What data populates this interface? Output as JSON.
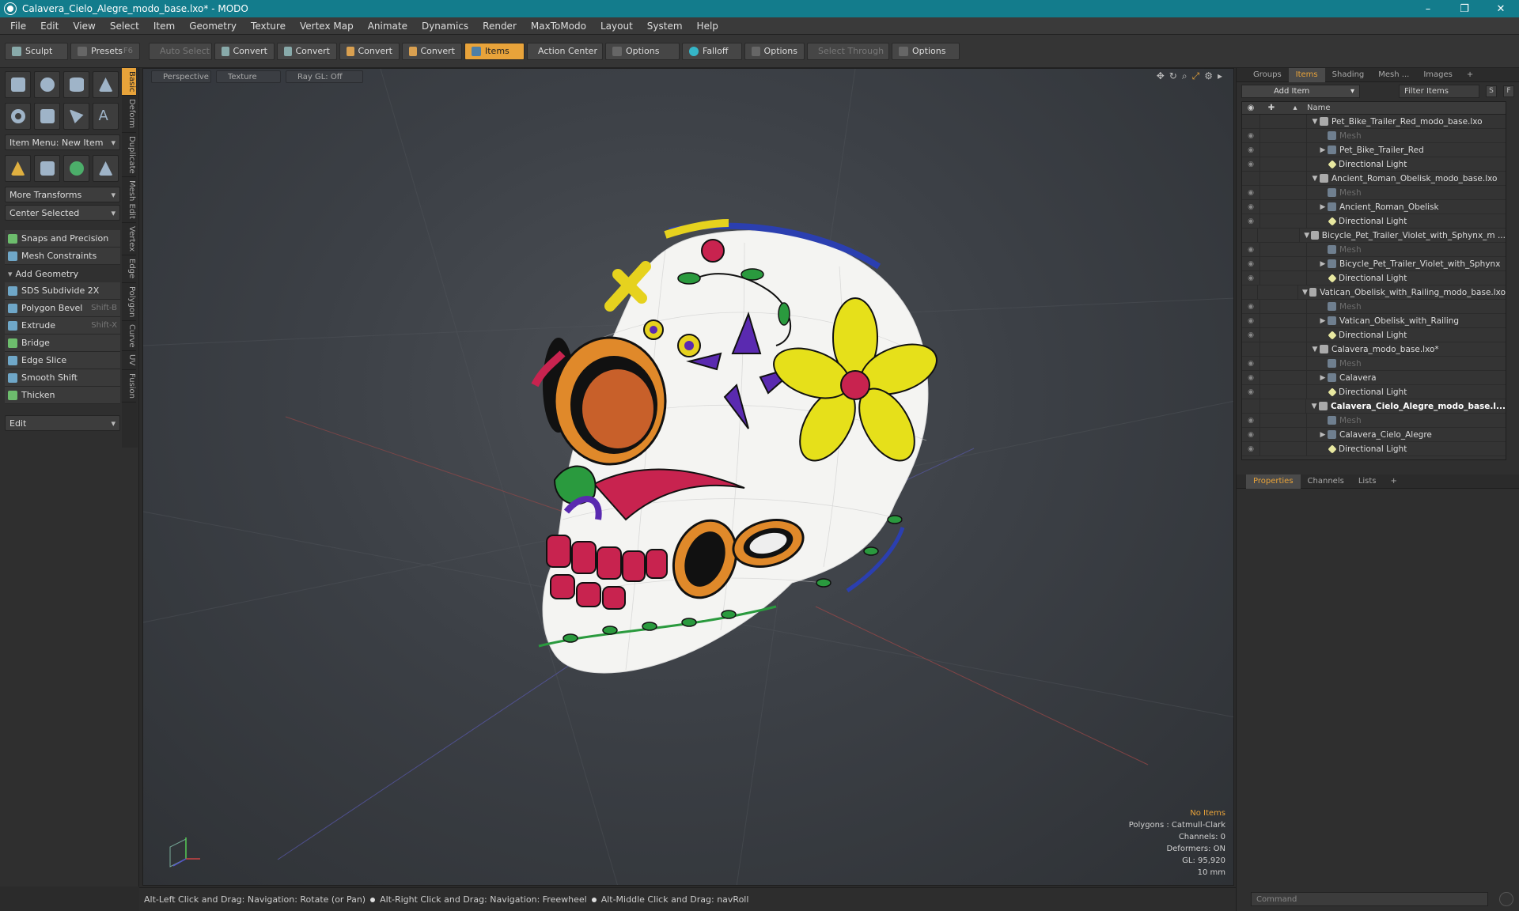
{
  "window": {
    "title": "Calavera_Cielo_Alegre_modo_base.lxo* - MODO",
    "min": "–",
    "max": "❐",
    "close": "✕"
  },
  "menu": [
    "File",
    "Edit",
    "View",
    "Select",
    "Item",
    "Geometry",
    "Texture",
    "Vertex Map",
    "Animate",
    "Dynamics",
    "Render",
    "MaxToModo",
    "Layout",
    "System",
    "Help"
  ],
  "toolbar": {
    "sculpt": "Sculpt",
    "presets": "Presets",
    "presets_key": "F6",
    "auto_select": "Auto Select",
    "convert": "Convert",
    "items": "Items",
    "action_center": "Action Center",
    "options": "Options",
    "falloff": "Falloff",
    "select_through": "Select Through"
  },
  "left": {
    "item_menu": "Item Menu: New Item",
    "more_transforms": "More Transforms",
    "center_selected": "Center Selected",
    "snaps": "Snaps and Precision",
    "mesh_constraints": "Mesh Constraints",
    "add_geometry": "Add Geometry",
    "tools": [
      {
        "label": "SDS Subdivide 2X",
        "key": ""
      },
      {
        "label": "Polygon Bevel",
        "key": "Shift-B"
      },
      {
        "label": "Extrude",
        "key": "Shift-X"
      },
      {
        "label": "Bridge",
        "key": ""
      },
      {
        "label": "Edge Slice",
        "key": ""
      },
      {
        "label": "Smooth Shift",
        "key": ""
      },
      {
        "label": "Thicken",
        "key": ""
      }
    ],
    "edit": "Edit",
    "vtabs": [
      "Basic",
      "Deform",
      "Duplicate",
      "Mesh Edit",
      "Vertex",
      "Edge",
      "Polygon",
      "Curve",
      "UV",
      "Fusion"
    ]
  },
  "viewport": {
    "perspective": "Perspective",
    "texture": "Texture",
    "raygl": "Ray GL: Off",
    "info": {
      "no_items": "No Items",
      "polygons": "Polygons : Catmull-Clark",
      "channels": "Channels: 0",
      "deformers": "Deformers: ON",
      "gl": "GL: 95,920",
      "scale": "10 mm"
    }
  },
  "right": {
    "tabs": [
      "Groups",
      "Items",
      "Shading",
      "Mesh ...",
      "Images"
    ],
    "add_item": "Add Item",
    "filter": "Filter Items",
    "s": "S",
    "f": "F",
    "name_col": "Name",
    "tree": [
      {
        "label": "Pet_Bike_Trailer_Red_modo_base.lxo",
        "level": 0,
        "type": "scene",
        "arrow": "▼"
      },
      {
        "label": "Mesh",
        "level": 1,
        "type": "mesh",
        "dim": true
      },
      {
        "label": "Pet_Bike_Trailer_Red",
        "level": 1,
        "type": "mesh",
        "arrow": "▶"
      },
      {
        "label": "Directional Light",
        "level": 1,
        "type": "light"
      },
      {
        "label": "Ancient_Roman_Obelisk_modo_base.lxo",
        "level": 0,
        "type": "scene",
        "arrow": "▼"
      },
      {
        "label": "Mesh",
        "level": 1,
        "type": "mesh",
        "dim": true
      },
      {
        "label": "Ancient_Roman_Obelisk",
        "level": 1,
        "type": "mesh",
        "arrow": "▶"
      },
      {
        "label": "Directional Light",
        "level": 1,
        "type": "light"
      },
      {
        "label": "Bicycle_Pet_Trailer_Violet_with_Sphynx_m ...",
        "level": 0,
        "type": "scene",
        "arrow": "▼"
      },
      {
        "label": "Mesh",
        "level": 1,
        "type": "mesh",
        "dim": true
      },
      {
        "label": "Bicycle_Pet_Trailer_Violet_with_Sphynx",
        "level": 1,
        "type": "mesh",
        "arrow": "▶"
      },
      {
        "label": "Directional Light",
        "level": 1,
        "type": "light"
      },
      {
        "label": "Vatican_Obelisk_with_Railing_modo_base.lxo",
        "level": 0,
        "type": "scene",
        "arrow": "▼"
      },
      {
        "label": "Mesh",
        "level": 1,
        "type": "mesh",
        "dim": true
      },
      {
        "label": "Vatican_Obelisk_with_Railing",
        "level": 1,
        "type": "mesh",
        "arrow": "▶"
      },
      {
        "label": "Directional Light",
        "level": 1,
        "type": "light"
      },
      {
        "label": "Calavera_modo_base.lxo*",
        "level": 0,
        "type": "scene",
        "arrow": "▼"
      },
      {
        "label": "Mesh",
        "level": 1,
        "type": "mesh",
        "dim": true
      },
      {
        "label": "Calavera",
        "level": 1,
        "type": "mesh",
        "arrow": "▶"
      },
      {
        "label": "Directional Light",
        "level": 1,
        "type": "light"
      },
      {
        "label": "Calavera_Cielo_Alegre_modo_base.l...",
        "level": 0,
        "type": "scene",
        "arrow": "▼",
        "bold": true
      },
      {
        "label": "Mesh",
        "level": 1,
        "type": "mesh",
        "dim": true
      },
      {
        "label": "Calavera_Cielo_Alegre",
        "level": 1,
        "type": "mesh",
        "arrow": "▶"
      },
      {
        "label": "Directional Light",
        "level": 1,
        "type": "light"
      }
    ],
    "prop_tabs": [
      "Properties",
      "Channels",
      "Lists"
    ],
    "command": "Command"
  },
  "status": [
    "Alt-Left Click and Drag: Navigation: Rotate (or Pan)",
    "Alt-Right Click and Drag: Navigation: Freewheel",
    "Alt-Middle Click and Drag: navRoll"
  ]
}
